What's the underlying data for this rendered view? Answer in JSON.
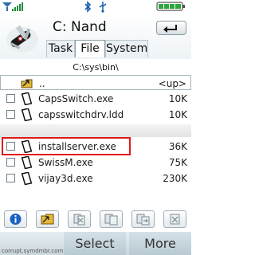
{
  "status_icons": [
    "signal-icon",
    "bluetooth-icon",
    "usb-icon",
    "battery-icon"
  ],
  "header": {
    "title": "C: Nand",
    "back_icon": "return-arrow-icon",
    "tabs": [
      {
        "label": "Task",
        "active": false
      },
      {
        "label": "File",
        "active": true
      },
      {
        "label": "System",
        "active": false
      }
    ]
  },
  "path": "C:\\sys\\bin\\",
  "files": [
    {
      "name": "..",
      "size": "<up>",
      "type": "folder-up"
    },
    {
      "name": "CapsSwitch.exe",
      "size": "10K",
      "type": "file"
    },
    {
      "name": "capsswitchdrv.ldd",
      "size": "10K",
      "type": "file"
    },
    {
      "name": "installserver.exe",
      "size": "36K",
      "type": "file",
      "highlighted": true
    },
    {
      "name": "SwissM.exe",
      "size": "75K",
      "type": "file"
    },
    {
      "name": "vijay3d.exe",
      "size": "230K",
      "type": "file"
    }
  ],
  "toolbar": [
    "info-icon",
    "folder-icon",
    "cut-icon",
    "copy-icon",
    "paste-icon",
    "delete-icon"
  ],
  "softkeys": {
    "left": "Select",
    "right": "More"
  },
  "watermark": "corrupt.symdmbr.com"
}
